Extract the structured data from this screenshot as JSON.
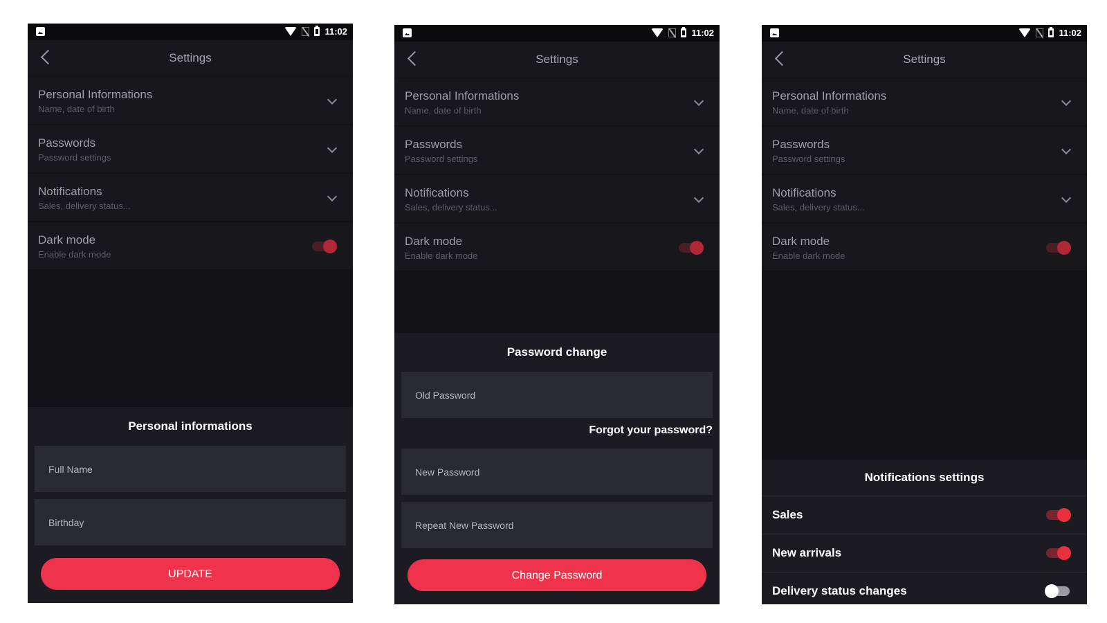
{
  "status_time": "11:02",
  "app_title": "Settings",
  "settings_items": [
    {
      "title": "Personal Informations",
      "subtitle": "Name, date of birth"
    },
    {
      "title": "Passwords",
      "subtitle": "Password settings"
    },
    {
      "title": "Notifications",
      "subtitle": "Sales, delivery status..."
    },
    {
      "title": "Dark mode",
      "subtitle": "Enable dark mode",
      "toggle_on": true
    }
  ],
  "personal_sheet": {
    "title": "Personal informations",
    "fields": [
      "Full Name",
      "Birthday"
    ],
    "button": "UPDATE"
  },
  "password_sheet": {
    "title": "Password change",
    "old_password": "Old Password",
    "forgot": "Forgot your password?",
    "new_password": "New Password",
    "repeat_password": "Repeat New Password",
    "button": "Change Password"
  },
  "notifications_sheet": {
    "title": "Notifications settings",
    "rows": [
      {
        "label": "Sales",
        "on": true
      },
      {
        "label": "New arrivals",
        "on": true
      },
      {
        "label": "Delivery status changes",
        "on": false
      }
    ]
  },
  "colors": {
    "accent": "#f0334d",
    "background": "#131217",
    "panel": "#1c1b21",
    "field": "#2a2a31"
  }
}
